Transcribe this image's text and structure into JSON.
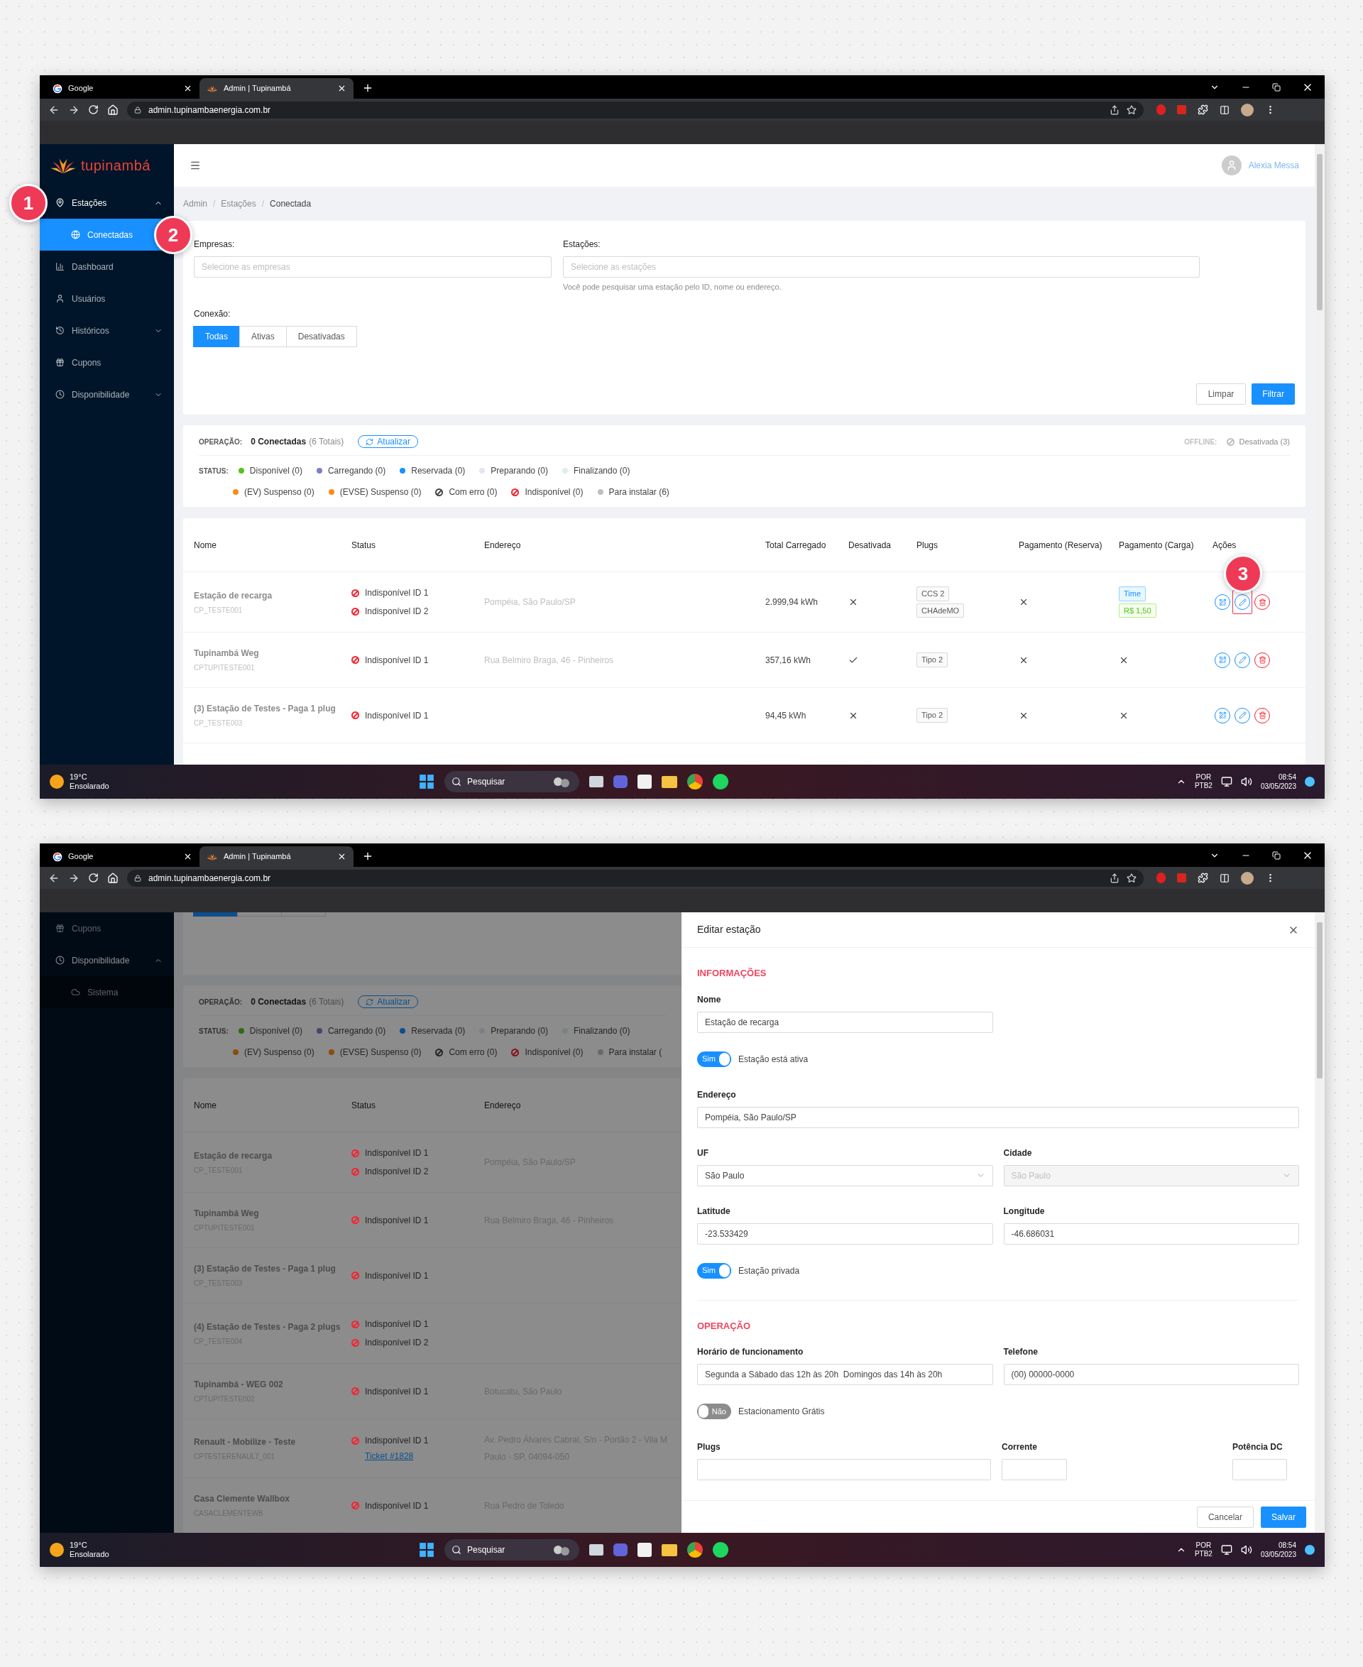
{
  "callouts": [
    {
      "number": "1"
    },
    {
      "number": "2"
    },
    {
      "number": "3"
    }
  ],
  "screens": [
    {
      "browser": {
        "tabs": [
          {
            "title": "Google",
            "kind": "google",
            "selected": false
          },
          {
            "title": "Admin | Tupinambá",
            "kind": "flower",
            "selected": true
          }
        ],
        "url": "admin.tupinambaenergia.com.br"
      },
      "sidebar": {
        "logo": "tupinambá",
        "items": [
          {
            "label": "Estações",
            "kind": "pin",
            "expanded": true,
            "children": [
              {
                "label": "Conectadas",
                "kind": "globe",
                "selected": true
              }
            ]
          },
          {
            "label": "Dashboard",
            "kind": "chart"
          },
          {
            "label": "Usuários",
            "kind": "user"
          },
          {
            "label": "Históricos",
            "kind": "history",
            "expanded": false
          },
          {
            "label": "Cupons",
            "kind": "gift"
          },
          {
            "label": "Disponibilidade",
            "kind": "clock",
            "expanded": false
          }
        ]
      },
      "header": {
        "user": "Alexia Messa"
      },
      "breadcrumb": {
        "separator": "/",
        "items": [
          "Admin",
          "Estações",
          "Conectada"
        ]
      },
      "filters": {
        "company_label": "Empresas:",
        "company_placeholder": "Selecione as empresas",
        "station_label": "Estações:",
        "station_placeholder": "Selecione as estações",
        "station_hint": "Você pode pesquisar uma estação pelo ID, nome ou endereço.",
        "connection_label": "Conexão:",
        "connection": [
          {
            "label": "Todas",
            "selected": true
          },
          {
            "label": "Ativas",
            "selected": false
          },
          {
            "label": "Desativadas",
            "selected": false
          }
        ],
        "clear": "Limpar",
        "apply": "Filtrar"
      },
      "status": {
        "operation_label": "OPERAÇÃO:",
        "connected": "0 Conectadas",
        "total": "(6 Totais)",
        "refresh": "Atualizar",
        "offline_label": "OFFLINE:",
        "offline": "Desativada (3)",
        "status_label": "STATUS:",
        "legend": [
          [
            {
              "label": "Disponível (0)",
              "kind": "dot",
              "color": "#52c41a"
            },
            {
              "label": "Carregando (0)",
              "kind": "dot",
              "color": "#7b7fc4"
            },
            {
              "label": "Reservada (0)",
              "kind": "dot",
              "color": "#1890ff"
            },
            {
              "label": "Preparando (0)",
              "kind": "dot",
              "color": "#e4e4f4"
            },
            {
              "label": "Finalizando (0)",
              "kind": "dot",
              "color": "#dcefe6"
            }
          ],
          [
            {
              "label": "(EV) Suspenso (0)",
              "kind": "dot",
              "color": "#fa8c16"
            },
            {
              "label": "(EVSE) Suspenso (0)",
              "kind": "dot",
              "color": "#fa8c16"
            },
            {
              "label": "Com erro (0)",
              "kind": "ban",
              "color": "#434343"
            },
            {
              "label": "Indisponível (0)",
              "kind": "ban",
              "color": "#f5222d"
            },
            {
              "label": "Para instalar (6)",
              "kind": "dot",
              "color": "#bfbfbf"
            }
          ]
        ]
      },
      "table": {
        "columns": [
          "Nome",
          "Status",
          "Endereço",
          "Total Carregado",
          "Desativada",
          "Plugs",
          "Pagamento (Reserva)",
          "Pagamento (Carga)",
          "Ações"
        ],
        "rows": [
          {
            "name": "Estação de recarga",
            "code": "CP_TESTE001",
            "statuses": [
              "Indisponível ID 1",
              "Indisponível ID 2"
            ],
            "address": [
              "Pompéia, São Paulo/SP"
            ],
            "total": "2.999,94 kWh",
            "disabled": false,
            "plugs": [
              "CCS 2",
              "CHAdeMO"
            ],
            "reserve_payment": false,
            "charge_payment": [
              {
                "label": "Time",
                "kind": "blue"
              },
              {
                "label": "R$ 1,50",
                "kind": "green"
              }
            ],
            "actions": [
              {
                "kind": "qr",
                "highlighted": false
              },
              {
                "kind": "edit",
                "highlighted": true
              },
              {
                "kind": "delete",
                "highlighted": false
              }
            ]
          },
          {
            "name": "Tupinambá Weg",
            "code": "CPTUPITESTE001",
            "statuses": [
              "Indisponível ID 1"
            ],
            "address": [
              "Rua Belmiro Braga, 46 - Pinheiros"
            ],
            "total": "357,16 kWh",
            "disabled": true,
            "plugs": [
              "Tipo 2"
            ],
            "reserve_payment": false,
            "charge_payment": false,
            "actions": [
              {
                "kind": "qr",
                "highlighted": false
              },
              {
                "kind": "edit",
                "highlighted": false
              },
              {
                "kind": "delete",
                "highlighted": false
              }
            ]
          },
          {
            "name": "(3) Estação de Testes - Paga 1 plug",
            "code": "CP_TESTE003",
            "statuses": [
              "Indisponível ID 1"
            ],
            "total": "94,45 kWh",
            "disabled": false,
            "plugs": [
              "Tipo 2"
            ],
            "reserve_payment": false,
            "charge_payment": false,
            "actions": [
              {
                "kind": "qr",
                "highlighted": false
              },
              {
                "kind": "edit",
                "highlighted": false
              },
              {
                "kind": "delete",
                "highlighted": false
              }
            ]
          }
        ]
      },
      "taskbar": {
        "temperature": "19°C",
        "weather": "Ensolarado",
        "search": "Pesquisar",
        "language": "POR",
        "layout": "PTB2",
        "time": "08:54",
        "date": "03/05/2023"
      }
    },
    {
      "browser": {
        "tabs": [
          {
            "title": "Google",
            "kind": "google",
            "selected": false
          },
          {
            "title": "Admin | Tupinambá",
            "kind": "flower",
            "selected": true
          }
        ],
        "url": "admin.tupinambaenergia.com.br"
      },
      "sidebar": {
        "items": [
          {
            "label": "Cupons",
            "kind": "gift"
          },
          {
            "label": "Disponibilidade",
            "kind": "clock",
            "expanded": true,
            "children": [
              {
                "label": "Sistema",
                "kind": "cloud",
                "selected": false
              }
            ]
          }
        ]
      },
      "filter_stub": {
        "connection": [
          {
            "selected": true
          },
          {
            "selected": false
          },
          {
            "selected": false
          }
        ]
      },
      "status": {
        "operation_label": "OPERAÇÃO:",
        "connected": "0 Conectadas",
        "total": "(6 Totais)",
        "refresh": "Atualizar",
        "status_label": "STATUS:",
        "legend": [
          [
            {
              "label": "Disponível (0)",
              "kind": "dot",
              "color": "#2d6c0e"
            },
            {
              "label": "Carregando (0)",
              "kind": "dot",
              "color": "#44466c"
            },
            {
              "label": "Reservada (0)",
              "kind": "dot",
              "color": "#0d4f8c"
            },
            {
              "label": "Preparando (0)",
              "kind": "dot",
              "color": "#7d7d86"
            },
            {
              "label": "Finalizando (0)",
              "kind": "dot",
              "color": "#79837f"
            }
          ],
          [
            {
              "label": "(EV) Suspenso (0)",
              "kind": "dot",
              "color": "#8a4d0c"
            },
            {
              "label": "(EVSE) Suspenso (0)",
              "kind": "dot",
              "color": "#8a4d0c"
            },
            {
              "label": "Com erro (0)",
              "kind": "ban",
              "color": "#252525"
            },
            {
              "label": "Indisponível (0)",
              "kind": "ban",
              "color": "#871319"
            },
            {
              "label": "Para instalar (",
              "kind": "dot",
              "color": "#696969"
            }
          ]
        ]
      },
      "table": {
        "columns": [
          "Nome",
          "Status",
          "Endereço"
        ],
        "rows": [
          {
            "name": "Estação de recarga",
            "code": "CP_TESTE001",
            "statuses": [
              "Indisponível ID 1",
              "Indisponível ID 2"
            ],
            "address": [
              "Pompéia, São Paulo/SP"
            ]
          },
          {
            "name": "Tupinambá Weg",
            "code": "CPTUPITESTE001",
            "statuses": [
              "Indisponível ID 1"
            ],
            "address": [
              "Rua Belmiro Braga, 46 - Pinheiros"
            ]
          },
          {
            "name": "(3) Estação de Testes - Paga 1 plug",
            "code": "CP_TESTE003",
            "statuses": [
              "Indisponível ID 1"
            ]
          },
          {
            "name": "(4) Estação de Testes - Paga 2 plugs",
            "code": "CP_TESTE004",
            "statuses": [
              "Indisponível ID 1",
              "Indisponível ID 2"
            ]
          },
          {
            "name": "Tupinambá - WEG 002",
            "code": "CPTUPITESTE002",
            "statuses": [
              "Indisponível ID 1"
            ],
            "address": [
              "Botucatu, São Paulo"
            ]
          },
          {
            "name": "Renault - Mobilize - Teste",
            "code": "CPTESTERENAULT_001",
            "statuses": [
              "Indisponível ID 1"
            ],
            "ticket": "Ticket #1828",
            "address": [
              "Av. Pedro Álvares Cabral, S/n - Portão 2 - Vila M",
              "Paulo - SP, 04094-050"
            ]
          },
          {
            "name": "Casa Clemente Wallbox",
            "code": "CASACLEMENTEWB",
            "statuses": [
              "Indisponível ID 1"
            ],
            "address": [
              "Rua Pedro de Toledo"
            ]
          }
        ]
      },
      "drawer": {
        "title": "Editar estação",
        "sections": [
          {
            "title": "INFORMAÇÕES",
            "rows": [
              {
                "kind": "fields",
                "fields": [
                  {
                    "label": "Nome",
                    "value": "Estação de recarga",
                    "kind": "input"
                  }
                ]
              },
              {
                "kind": "toggle",
                "on": true,
                "text": "Sim",
                "label": "Estação está ativa"
              },
              {
                "kind": "fields",
                "fields": [
                  {
                    "label": "Endereço",
                    "value": "Pompéia, São Paulo/SP",
                    "kind": "input",
                    "wide": true
                  }
                ]
              },
              {
                "kind": "fields",
                "fields": [
                  {
                    "label": "UF",
                    "value": "São Paulo",
                    "kind": "select",
                    "disabled": false
                  },
                  {
                    "label": "Cidade",
                    "value": "São Paulo",
                    "kind": "select",
                    "disabled": true
                  }
                ]
              },
              {
                "kind": "fields",
                "fields": [
                  {
                    "label": "Latitude",
                    "value": "-23.533429",
                    "kind": "input"
                  },
                  {
                    "label": "Longitude",
                    "value": "-46.686031",
                    "kind": "input"
                  }
                ]
              },
              {
                "kind": "toggle",
                "on": true,
                "text": "Sim",
                "label": "Estação privada"
              }
            ]
          },
          {
            "title": "OPERAÇÃO",
            "rows": [
              {
                "kind": "fields",
                "fields": [
                  {
                    "label": "Horário de funcionamento",
                    "value": "Segunda a Sábado das 12h às 20h  Domingos das 14h às 20h",
                    "kind": "input"
                  },
                  {
                    "label": "Telefone",
                    "value": "(00) 00000-0000",
                    "kind": "input"
                  }
                ]
              },
              {
                "kind": "toggle",
                "on": false,
                "text": "Não",
                "label": "Estacionamento Grátis"
              },
              {
                "kind": "cut",
                "labels": [
                  "Plugs",
                  "Corrente",
                  "Potência DC"
                ]
              }
            ]
          }
        ],
        "cancel": "Cancelar",
        "save": "Salvar"
      },
      "taskbar": {
        "temperature": "19°C",
        "weather": "Ensolarado",
        "search": "Pesquisar",
        "language": "POR",
        "layout": "PTB2",
        "time": "08:54",
        "date": "03/05/2023"
      }
    }
  ]
}
